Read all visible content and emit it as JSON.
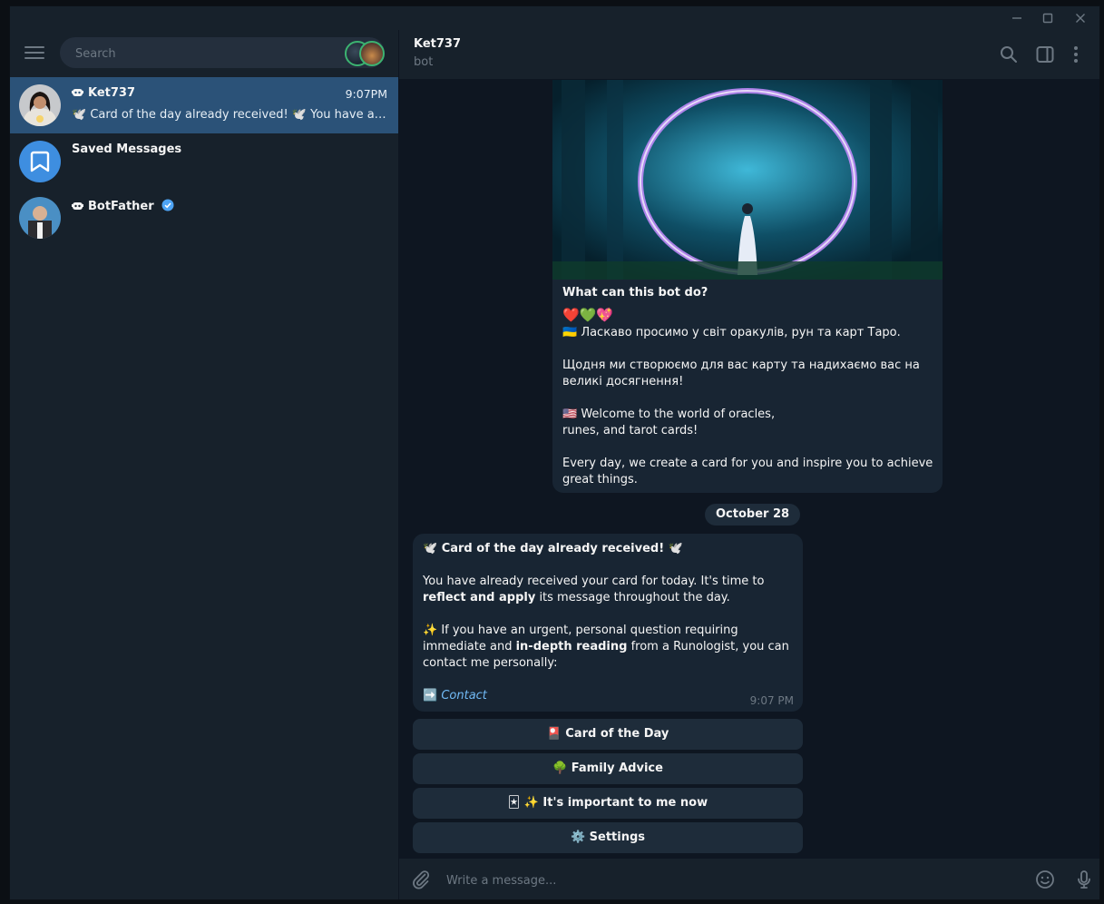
{
  "window": {
    "controls": {
      "minimize": "—",
      "maximize": "☐",
      "close": "✕"
    }
  },
  "sidebar": {
    "search_placeholder": "Search",
    "chats": [
      {
        "name": "Ket737",
        "time": "9:07PM",
        "preview": "🕊️ Card of the day already received! 🕊️ You have already received your card for today.",
        "is_bot": true,
        "active": true
      },
      {
        "name": "Saved Messages",
        "time": "",
        "preview": "",
        "is_bot": false,
        "active": false
      },
      {
        "name": "BotFather",
        "time": "",
        "preview": "",
        "is_bot": true,
        "verified": true,
        "active": false
      }
    ]
  },
  "header": {
    "title": "Ket737",
    "status": "bot",
    "icons": [
      "search-icon",
      "sidebar-toggle-icon",
      "more-vertical-icon"
    ]
  },
  "intro": {
    "heading": "What can this bot do?",
    "hearts": "❤️💚💖",
    "ua_line": "🇺🇦 Ласкаво просимо у світ оракулів, рун та карт Таро.",
    "ua_line2": "Щодня ми створюємо для вас карту та надихаємо вас на великі досягнення!",
    "en_line1": "🇺🇸 Welcome to the world of oracles,",
    "en_line2": "runes, and tarot cards!",
    "en_line3": "Every day, we create a card for you and inspire you to achieve great things."
  },
  "date_divider": "October 28",
  "message": {
    "title": "🕊️ Card of the day already received! 🕊️",
    "p1_a": "You have already received your card for today. It's time to ",
    "p1_b": "reflect and apply",
    "p1_c": " its message throughout the day.",
    "p2_a": "✨ If you have an urgent, personal question requiring immediate and ",
    "p2_b": "in-depth reading",
    "p2_c": " from a Runologist, you can contact me personally:",
    "contact_arrow": "➡️",
    "contact_link": "Contact",
    "time": "9:07 PM"
  },
  "keyboard": [
    {
      "label": "🎴 Card of the Day"
    },
    {
      "label": "🌳 Family Advice"
    },
    {
      "label": "🃏 ✨ It's important to me now"
    },
    {
      "label": "⚙️ Settings"
    }
  ],
  "composer": {
    "placeholder": "Write a message...",
    "icons": [
      "attach-icon",
      "emoji-icon",
      "microphone-icon"
    ]
  },
  "colors": {
    "sidebar_bg": "#17212b",
    "active_chat": "#2b5278",
    "chat_bg": "#0e1621",
    "bubble": "#182533",
    "link": "#71baf5",
    "verified": "#4ea4f5"
  }
}
